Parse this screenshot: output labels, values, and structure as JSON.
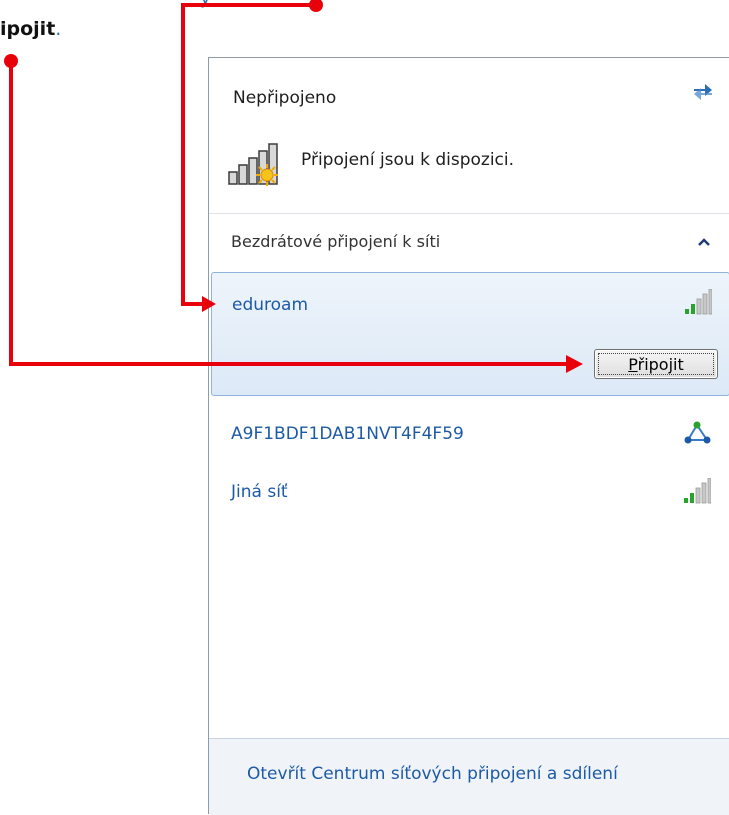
{
  "instruction": {
    "visible_text": "ipojit",
    "period": ".",
    "fragment": "y"
  },
  "panel": {
    "status_title": "Nepřipojeno",
    "status_text": "Připojení jsou k dispozici.",
    "section_title": "Bezdrátové připojení k síti",
    "networks": [
      {
        "name": "eduroam",
        "icon": "wifi-signal-icon",
        "selected": true
      },
      {
        "name": "A9F1BDF1DAB1NVT4F4F59",
        "icon": "adhoc-network-icon",
        "selected": false
      },
      {
        "name": "Jiná síť",
        "icon": "wifi-signal-icon",
        "selected": false
      }
    ],
    "connect_button": {
      "accel": "P",
      "rest": "řipojit"
    },
    "footer_link": "Otevřít Centrum síťových připojení a sdílení"
  },
  "colors": {
    "link": "#1d5aa6",
    "annotation_red": "#e8000b",
    "selection_bg": "#dce9f7"
  }
}
